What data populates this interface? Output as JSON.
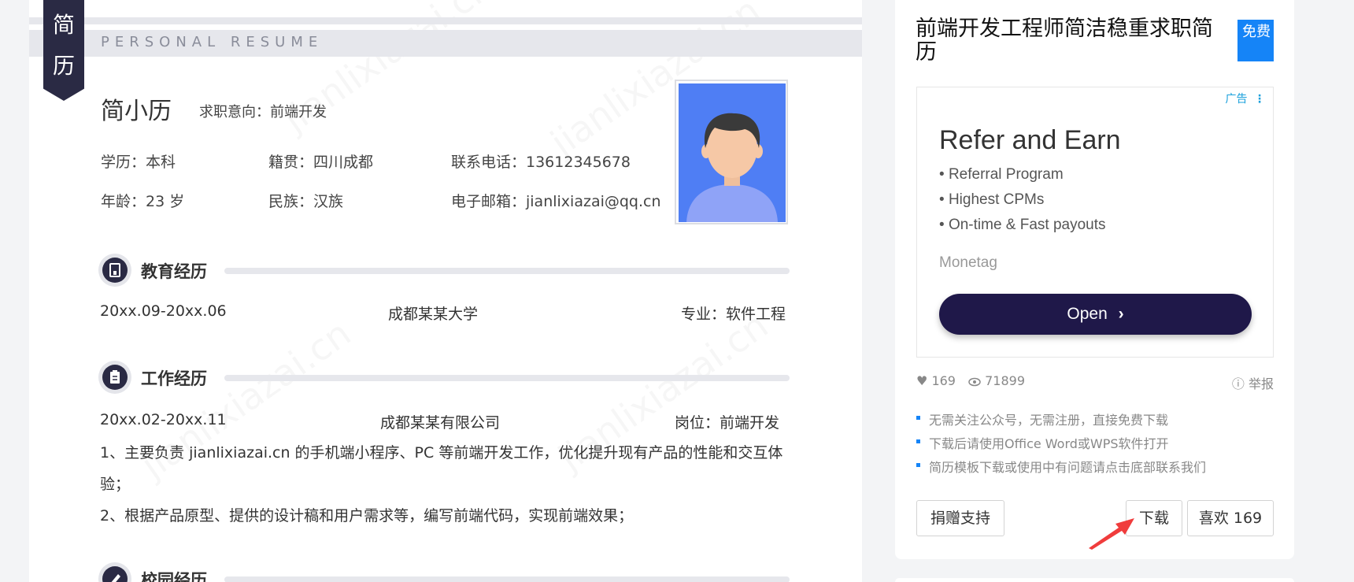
{
  "resume": {
    "ribbon": [
      "简",
      "历"
    ],
    "banner": "PERSONAL RESUME",
    "watermark": "jianlixiazai.cn",
    "name": "简小历",
    "intent": "求职意向：前端开发",
    "info": {
      "education": "学历：本科",
      "hometown": "籍贯：四川成都",
      "phone": "联系电话：13612345678",
      "age": "年龄：23 岁",
      "ethnicity": "民族：汉族",
      "email": "电子邮箱：jianlixiazai@qq.cn"
    },
    "sections": {
      "education": {
        "title": "教育经历",
        "period": "20xx.09-20xx.06",
        "school": "成都某某大学",
        "major": "专业：软件工程"
      },
      "work": {
        "title": "工作经历",
        "period": "20xx.02-20xx.11",
        "company": "成都某某有限公司",
        "position": "岗位：前端开发",
        "duties": [
          "1、主要负责 jianlixiazai.cn 的手机端小程序、PC 等前端开发工作，优化提升现有产品的性能和交互体验；",
          "2、根据产品原型、提供的设计稿和用户需求等，编写前端代码，实现前端效果；"
        ]
      },
      "campus": {
        "title": "校园经历"
      }
    }
  },
  "side": {
    "title": "前端开发工程师简洁稳重求职简历",
    "badge": "免费",
    "ad": {
      "tag": "广告",
      "title": "Refer and Earn",
      "items": [
        "Referral Program",
        "Highest CPMs",
        "On-time & Fast payouts"
      ],
      "brand": "Monetag",
      "button": "Open"
    },
    "stats": {
      "likes": "169",
      "views": "71899",
      "report": "举报"
    },
    "tips": [
      "无需关注公众号，无需注册，直接免费下载",
      "下载后请使用Office Word或WPS软件打开",
      "简历模板下载或使用中有问题请点击底部联系我们"
    ],
    "buttons": {
      "donate": "捐赠支持",
      "download": "下载",
      "like": "喜欢 169"
    }
  },
  "colors": {
    "accent": "#1584f7",
    "dark": "#2a2a44",
    "ad_button": "#1f1849",
    "arrow": "#f03c3c"
  }
}
